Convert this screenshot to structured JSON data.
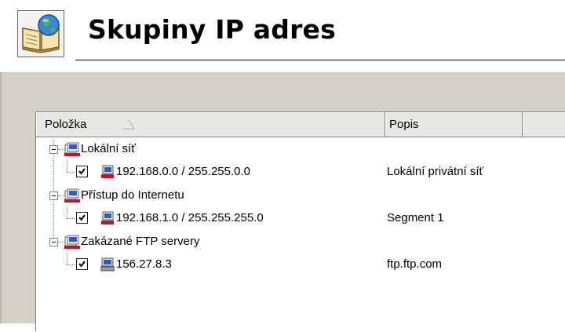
{
  "header": {
    "title": "Skupiny IP adres",
    "icon": "book-globe-icon"
  },
  "list": {
    "columns": [
      {
        "label": "Položka",
        "sort": "ascending"
      },
      {
        "label": "Popis"
      },
      {
        "label": ""
      }
    ],
    "groups": [
      {
        "label": "Lokální síť",
        "expanded": true,
        "icon": "network-group-icon",
        "items": [
          {
            "checked": true,
            "icon": "network-range-icon",
            "label": "192.168.0.0 / 255.255.0.0",
            "description": "Lokální privátní síť"
          }
        ]
      },
      {
        "label": "Přístup do Internetu",
        "expanded": true,
        "icon": "network-group-icon",
        "items": [
          {
            "checked": true,
            "icon": "network-range-icon",
            "label": "192.168.1.0 / 255.255.255.0",
            "description": "Segment 1"
          }
        ]
      },
      {
        "label": "Zakázané FTP servery",
        "expanded": true,
        "icon": "network-group-icon",
        "items": [
          {
            "checked": true,
            "icon": "computer-host-icon",
            "label": "156.27.8.3",
            "description": "ftp.ftp.com"
          }
        ]
      }
    ]
  },
  "colors": {
    "panel": "#d4d0c8",
    "header_bg": "#e9e7e1",
    "icon_red": "#c8102e",
    "icon_blue": "#2a5bd7"
  }
}
